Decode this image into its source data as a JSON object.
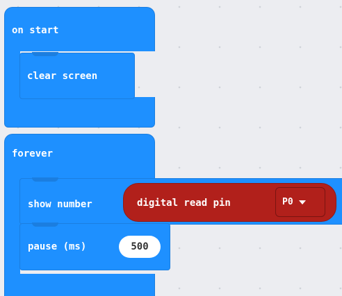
{
  "workspace": {
    "on_start": {
      "hat_label": "on start",
      "child_label": "clear screen"
    },
    "forever": {
      "hat_label": "forever",
      "show_number_label": "show number",
      "reporter_label": "digital read pin",
      "pin_value": "P0",
      "pause_label": "pause (ms)",
      "pause_value": "500"
    }
  },
  "colors": {
    "basic_block": "#1e90ff",
    "pins_block": "#b1201b",
    "workspace_bg": "#ecedf1"
  }
}
